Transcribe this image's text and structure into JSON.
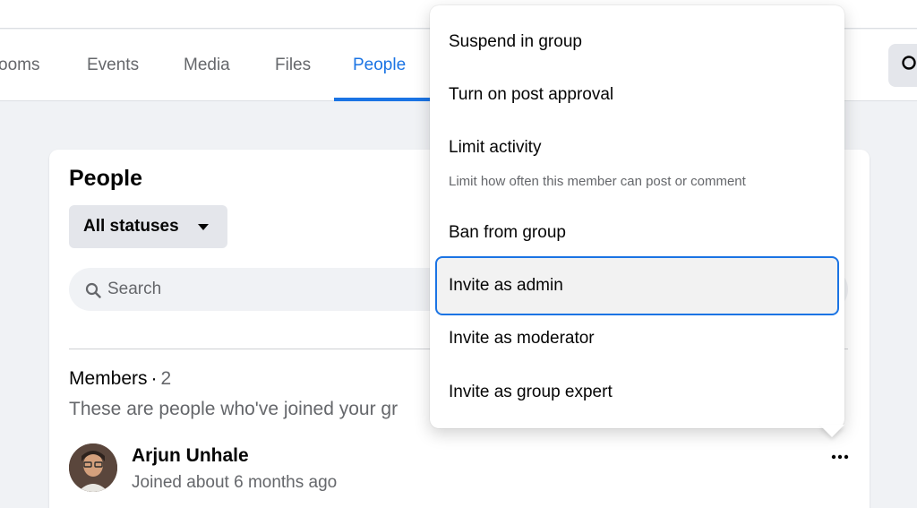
{
  "tabs": [
    {
      "label": "ooms",
      "active": false
    },
    {
      "label": "Events",
      "active": false
    },
    {
      "label": "Media",
      "active": false
    },
    {
      "label": "Files",
      "active": false
    },
    {
      "label": "People",
      "active": true
    }
  ],
  "people_card": {
    "title": "People",
    "status_filter": "All statuses",
    "search_placeholder": "Search",
    "members_label": "Members",
    "members_separator": "·",
    "members_count": "2",
    "members_description": "These are people who've joined your gr",
    "member": {
      "name": "Arjun Unhale",
      "joined": "Joined about 6 months ago"
    }
  },
  "menu": {
    "items": [
      {
        "label": "Suspend in group"
      },
      {
        "label": "Turn on post approval"
      },
      {
        "label": "Limit activity",
        "description": "Limit how often this member can post or comment"
      },
      {
        "label": "Ban from group"
      },
      {
        "label": "Invite as admin",
        "highlighted": true
      },
      {
        "label": "Invite as moderator"
      },
      {
        "label": "Invite as group expert"
      }
    ]
  },
  "colors": {
    "accent": "#1b74e4",
    "page_background": "#f0f2f5",
    "secondary_text": "#65676b"
  },
  "icons": [
    "search-icon",
    "caret-down-icon",
    "more-icon",
    "avatar"
  ]
}
